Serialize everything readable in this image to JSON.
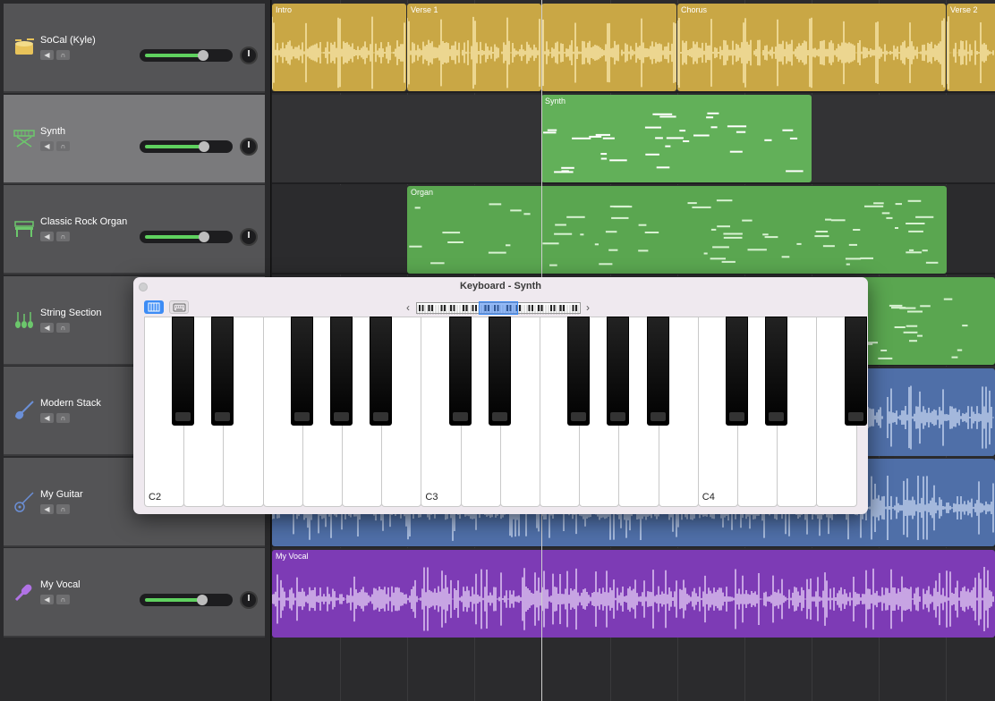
{
  "tracks": [
    {
      "name": "SoCal (Kyle)",
      "icon": "drum-kit-icon",
      "icon_color": "#e8c35a",
      "volume": 0.72,
      "pan": "center",
      "selected": false
    },
    {
      "name": "Synth",
      "icon": "synth-keyboard-icon",
      "icon_color": "#6cc76c",
      "volume": 0.73,
      "pan": "right",
      "selected": true
    },
    {
      "name": "Classic Rock Organ",
      "icon": "organ-icon",
      "icon_color": "#6cc76c",
      "volume": 0.73,
      "pan": "slight-right",
      "selected": false
    },
    {
      "name": "String Section",
      "icon": "strings-icon",
      "icon_color": "#6cc76c",
      "volume": null,
      "pan": null,
      "selected": false
    },
    {
      "name": "Modern Stack",
      "icon": "electric-guitar-icon",
      "icon_color": "#6b8fd6",
      "volume": null,
      "pan": null,
      "selected": false
    },
    {
      "name": "My Guitar",
      "icon": "acoustic-guitar-icon",
      "icon_color": "#6b8fd6",
      "volume": null,
      "pan": null,
      "selected": false
    },
    {
      "name": "My Vocal",
      "icon": "microphone-icon",
      "icon_color": "#b173e6",
      "volume": 0.71,
      "pan": "center",
      "selected": false
    }
  ],
  "mute_glyph": "◀",
  "solo_glyph": "∩",
  "regions": {
    "drums": [
      "Intro",
      "Verse 1",
      "",
      "Chorus",
      "Verse 2"
    ],
    "synth": "Synth",
    "organ": "Organ",
    "vocal": "My Vocal"
  },
  "colors": {
    "drums": "#c9a745",
    "midi": "#5aa650",
    "midi_selected": "#62b059",
    "audio_blue": "#4f6fa8",
    "vocal": "#7d3bb5",
    "accent": "#3d8cf5"
  },
  "keyboard_window": {
    "title": "Keyboard - Synth",
    "prev_label": "‹",
    "next_label": "›",
    "note_labels": [
      "C2",
      "C3",
      "C4"
    ]
  }
}
